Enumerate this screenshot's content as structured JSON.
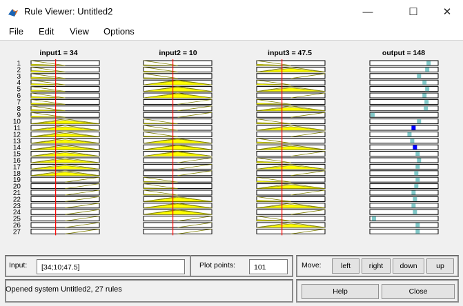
{
  "window": {
    "title": "Rule Viewer: Untitled2",
    "controls": {
      "minimize": "—",
      "maximize": "☐",
      "close": "✕"
    }
  },
  "menu": [
    "File",
    "Edit",
    "View",
    "Options"
  ],
  "plot": {
    "headers": [
      "input1 = 34",
      "input2 = 10",
      "input3 = 47.5",
      "output = 148"
    ],
    "rule_numbers": [
      "1",
      "2",
      "3",
      "4",
      "5",
      "6",
      "7",
      "8",
      "9",
      "10",
      "11",
      "12",
      "13",
      "14",
      "15",
      "16",
      "17",
      "18",
      "19",
      "20",
      "21",
      "22",
      "23",
      "24",
      "25",
      "26",
      "27"
    ],
    "input_value_fractions": [
      0.36,
      0.43,
      0.37
    ],
    "output_point_fractions": [
      0.86,
      0.84,
      0.72,
      0.8,
      0.84,
      0.8,
      0.83,
      0.82,
      0.04,
      0.72,
      0.64,
      0.58,
      0.62,
      0.66,
      0.7,
      0.72,
      0.7,
      0.68,
      0.7,
      0.68,
      0.64,
      0.66,
      0.64,
      0.66,
      0.06,
      0.7,
      0.7
    ],
    "highlighted_output_rules": [
      "11",
      "14"
    ],
    "colors": {
      "mf_fill": "#ffff00",
      "mf_line": "#808000",
      "indicator": "#ff0000",
      "output_point": "#80c8c8",
      "output_point_active": "#0000ff"
    }
  },
  "controls": {
    "input_label": "Input:",
    "input_value": "[34;10;47.5]",
    "plot_points_label": "Plot points:",
    "plot_points_value": "101",
    "move_label": "Move:",
    "move_buttons": [
      "left",
      "right",
      "down",
      "up"
    ],
    "help_label": "Help",
    "close_label": "Close",
    "status": "Opened system Untitled2, 27 rules"
  }
}
